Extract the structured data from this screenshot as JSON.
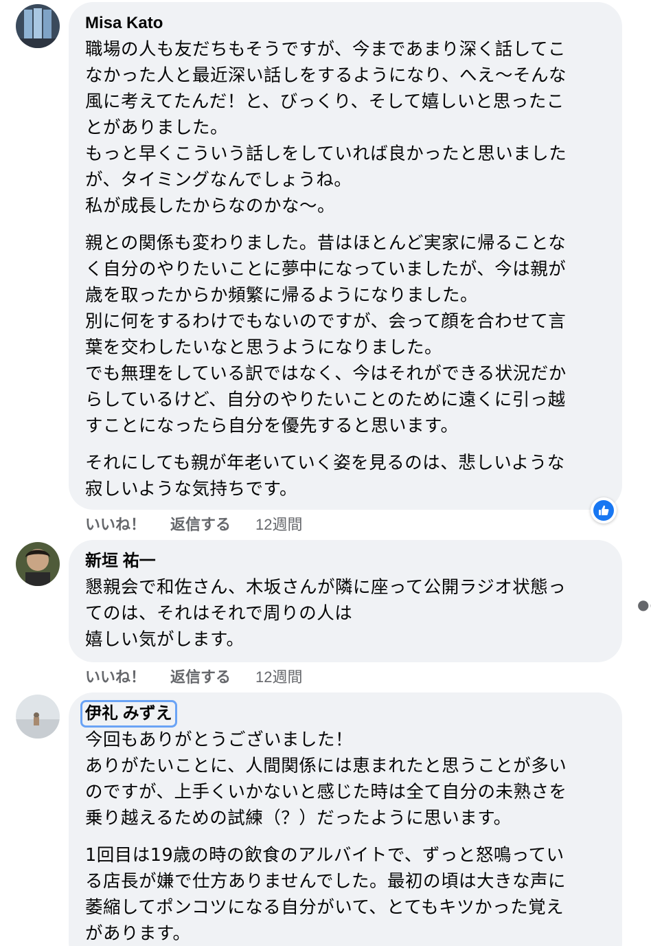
{
  "comments": [
    {
      "author": "Misa Kato",
      "paragraphs": [
        [
          "職場の人も友だちもそうですが、今まであまり深く話してこ",
          "なかった人と最近深い話しをするようになり、へえ〜そんな",
          "風に考えてたんだ！と、びっくり、そして嬉しいと思ったこ",
          "とがありました。",
          "もっと早くこういう話しをしていれば良かったと思いました",
          "が、タイミングなんでしょうね。",
          "私が成長したからなのかな〜。"
        ],
        [
          "親との関係も変わりました。昔はほとんど実家に帰ることな",
          "く自分のやりたいことに夢中になっていましたが、今は親が",
          "歳を取ったからか頻繁に帰るようになりました。",
          "別に何をするわけでもないのですが、会って顔を合わせて言",
          "葉を交わしたいなと思うようになりました。",
          "でも無理をしている訳ではなく、今はそれができる状況だか",
          "らしているけど、自分のやりたいことのために遠くに引っ越",
          "すことになったら自分を優先すると思います。"
        ],
        [
          "それにしても親が年老いていく姿を見るのは、悲しいような",
          "寂しいような気持ちです。"
        ]
      ],
      "actions": {
        "like": "いいね！",
        "reply": "返信する",
        "time": "12週間"
      },
      "reaction_icon": "thumbs-up-icon"
    },
    {
      "author": "新垣 祐一",
      "paragraphs": [
        [
          "懇親会で和佐さん、木坂さんが隣に座って公開ラジオ状態っ",
          "てのは、それはそれで周りの人は",
          "嬉しい気がします。"
        ]
      ],
      "actions": {
        "like": "いいね！",
        "reply": "返信する",
        "time": "12週間"
      }
    },
    {
      "author": "伊礼 みずえ",
      "paragraphs": [
        [
          "今回もありがとうございました！",
          "ありがたいことに、人間関係には恵まれたと思うことが多い",
          "のですが、上手くいかないと感じた時は全て自分の未熟さを",
          "乗り越えるための試練（？）だったように思います。"
        ],
        [
          "1回目は19歳の時の飲食のアルバイトで、ずっと怒鳴ってい",
          "る店長が嫌で仕方ありませんでした。最初の頃は大きな声に",
          "萎縮してポンコツになる自分がいて、とてもキツかった覚え",
          "があります。"
        ]
      ]
    }
  ],
  "colors": {
    "bubble": "#f0f2f5",
    "secondary_text": "#65676b",
    "like_blue": "#1877f2",
    "selection_outline": "#6aa3f5"
  },
  "icons": {
    "more": "more-horizontal-icon"
  }
}
